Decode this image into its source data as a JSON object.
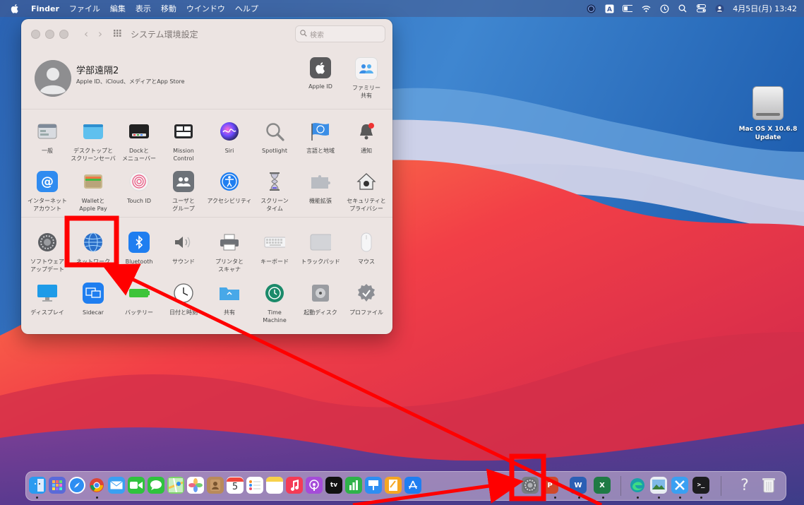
{
  "menubar": {
    "app": "Finder",
    "items": [
      "ファイル",
      "編集",
      "表示",
      "移動",
      "ウインドウ",
      "ヘルプ"
    ],
    "clock": "4月5日(月) 13:42",
    "status_icons": [
      "siri-orb-icon",
      "input-a-icon",
      "battery-icon",
      "wifi-icon",
      "time-machine-icon",
      "spotlight-icon",
      "control-center-icon",
      "profile-icon"
    ]
  },
  "window": {
    "title": "システム環境設定",
    "search_placeholder": "検索",
    "account": {
      "name": "学部遠隔2",
      "subtitle": "Apple ID、iCloud、メディアとApp Store",
      "apple_id_label": "Apple ID",
      "family_label_1": "ファミリー",
      "family_label_2": "共有"
    },
    "row1": [
      {
        "l1": "一般",
        "l2": ""
      },
      {
        "l1": "デスクトップと",
        "l2": "スクリーンセーバ"
      },
      {
        "l1": "Dockと",
        "l2": "メニューバー"
      },
      {
        "l1": "Mission",
        "l2": "Control"
      },
      {
        "l1": "Siri",
        "l2": ""
      },
      {
        "l1": "Spotlight",
        "l2": ""
      },
      {
        "l1": "言語と地域",
        "l2": ""
      },
      {
        "l1": "通知",
        "l2": ""
      }
    ],
    "row2": [
      {
        "l1": "インターネット",
        "l2": "アカウント"
      },
      {
        "l1": "Walletと",
        "l2": "Apple Pay"
      },
      {
        "l1": "Touch ID",
        "l2": ""
      },
      {
        "l1": "ユーザと",
        "l2": "グループ"
      },
      {
        "l1": "アクセシビリティ",
        "l2": ""
      },
      {
        "l1": "スクリーン",
        "l2": "タイム"
      },
      {
        "l1": "機能拡張",
        "l2": ""
      },
      {
        "l1": "セキュリティと",
        "l2": "プライバシー"
      }
    ],
    "row3": [
      {
        "l1": "ソフトウェア",
        "l2": "アップデート"
      },
      {
        "l1": "ネットワーク",
        "l2": ""
      },
      {
        "l1": "Bluetooth",
        "l2": ""
      },
      {
        "l1": "サウンド",
        "l2": ""
      },
      {
        "l1": "プリンタと",
        "l2": "スキャナ"
      },
      {
        "l1": "キーボード",
        "l2": ""
      },
      {
        "l1": "トラックパッド",
        "l2": ""
      },
      {
        "l1": "マウス",
        "l2": ""
      }
    ],
    "row4": [
      {
        "l1": "ディスプレイ",
        "l2": ""
      },
      {
        "l1": "Sidecar",
        "l2": ""
      },
      {
        "l1": "バッテリー",
        "l2": ""
      },
      {
        "l1": "日付と時刻",
        "l2": ""
      },
      {
        "l1": "共有",
        "l2": ""
      },
      {
        "l1": "Time",
        "l2": "Machine"
      },
      {
        "l1": "起動ディスク",
        "l2": ""
      },
      {
        "l1": "プロファイル",
        "l2": ""
      }
    ]
  },
  "desktop": {
    "drive_label_1": "Mac OS X 10.6.8",
    "drive_label_2": "Update"
  },
  "dock": {
    "calendar_day": "5",
    "apps": [
      "finder",
      "launchpad",
      "safari",
      "chrome",
      "mail",
      "facetime",
      "messages",
      "maps",
      "photos",
      "contacts",
      "calendar",
      "reminders",
      "notes",
      "music",
      "podcasts",
      "tv",
      "numbers",
      "keynote-pages",
      "app-store",
      "system-preferences",
      "powerpoint",
      "word",
      "excel",
      "edge",
      "preview",
      "utility",
      "terminal",
      "help",
      "trash"
    ]
  },
  "annotation_color": "#ff0000"
}
